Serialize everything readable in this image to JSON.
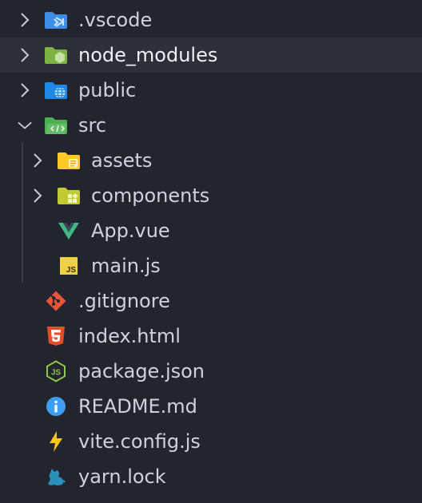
{
  "explorer": {
    "items": [
      {
        "label": ".vscode",
        "icon": "vscode-folder-icon",
        "chevron": "right"
      },
      {
        "label": "node_modules",
        "icon": "node-folder-icon",
        "chevron": "right"
      },
      {
        "label": "public",
        "icon": "public-folder-icon",
        "chevron": "right"
      },
      {
        "label": "src",
        "icon": "src-folder-icon",
        "chevron": "down"
      },
      {
        "label": "assets",
        "icon": "assets-folder-icon",
        "chevron": "right"
      },
      {
        "label": "components",
        "icon": "components-folder-icon",
        "chevron": "right"
      },
      {
        "label": "App.vue",
        "icon": "vue-icon"
      },
      {
        "label": "main.js",
        "icon": "javascript-icon"
      },
      {
        "label": ".gitignore",
        "icon": "git-icon"
      },
      {
        "label": "index.html",
        "icon": "html5-icon"
      },
      {
        "label": "package.json",
        "icon": "nodejs-icon"
      },
      {
        "label": "README.md",
        "icon": "info-icon"
      },
      {
        "label": "vite.config.js",
        "icon": "vite-icon"
      },
      {
        "label": "yarn.lock",
        "icon": "yarn-icon"
      }
    ]
  },
  "colors": {
    "background": "#22252d",
    "selected_row": "#2b2f38",
    "text": "#cdd3de",
    "vue": "#41b883",
    "javascript": "#f1d144",
    "git": "#e8563a",
    "html": "#e44d26",
    "node": "#8cc84b",
    "info": "#3e9df4",
    "vite": "#ffc517",
    "yarn": "#2c8ebb"
  }
}
